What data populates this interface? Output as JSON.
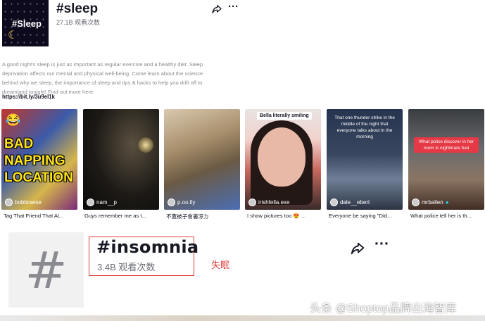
{
  "sleep_header": {
    "cover_text": "#Sleep",
    "title": "#sleep",
    "views": "27.1B 观看次数"
  },
  "description": {
    "text": "A good night's sleep is just as important as regular exercise and a healthy diet. Sleep deprivation affects our mental and physical well-being. Come learn about the science behind why we sleep, the importance of sleep and tips & hacks to help you drift off to dreamland tonight! Find out more here:",
    "link": "https://bit.ly/3u9eI1k"
  },
  "videos": [
    {
      "overlay": "BAD NAPPING LOCATION",
      "username": "bobbreese",
      "caption": "Tag That Friend That Al..."
    },
    {
      "overlay": "",
      "username": "nam__p",
      "caption": "Guys remember me as t..."
    },
    {
      "overlay": "",
      "username": "p.oo.lly",
      "caption": "不蓋被子會著涼ㄉ"
    },
    {
      "overlay": "Bella literally smiling",
      "username": "irishfella.exe",
      "caption": "I show pictures too 😍 ..."
    },
    {
      "overlay": "That one thunder strike in the middle of the night that everyone talks about in the morning",
      "username": "dale__ebert",
      "caption": "Everyone be saying \"Did..."
    },
    {
      "overlay": "What police discover in her room is nightmare fuel",
      "username": "mrballen",
      "caption": "What police tell her is th..."
    }
  ],
  "insomnia": {
    "title": "#insomnia",
    "views": "3.4B 观看次数",
    "note": "失眠"
  },
  "watermark": "头条 @Shoptop品牌出海智库",
  "colors": {
    "accent_red": "#e03a3a",
    "text_primary": "#161823",
    "text_secondary": "#6b6d76"
  }
}
